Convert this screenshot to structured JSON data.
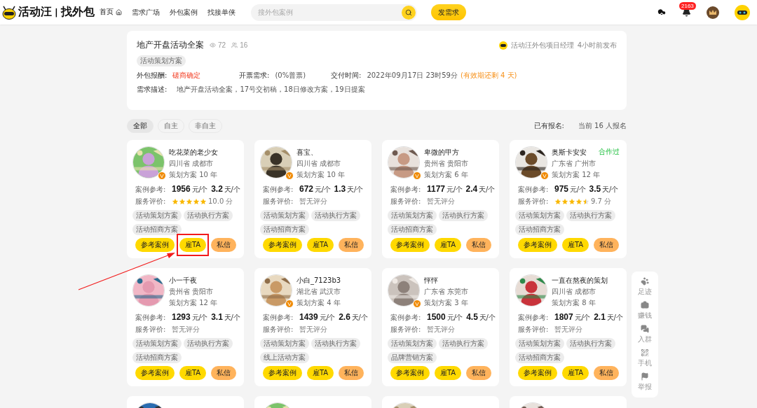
{
  "header": {
    "logo_text": "活动汪",
    "logo_divider": "|",
    "logo_sub": "找外包",
    "nav": [
      {
        "label": "首页",
        "selected": true
      },
      {
        "label": "需求广场",
        "selected": false
      },
      {
        "label": "外包案例",
        "selected": false
      },
      {
        "label": "找接单侠",
        "selected": false
      }
    ],
    "search": {
      "placeholder": "搜外包案例"
    },
    "post_button": "发需求",
    "notification_count": "2163"
  },
  "demand": {
    "title": "地产开盘活动全案",
    "views": "72",
    "applicants": "16",
    "publisher": "活动汪外包项目经理",
    "posted": "4小时前发布",
    "tags": [
      "活动策划方案"
    ],
    "info": [
      {
        "label": "外包报酬:",
        "value": "磋商确定",
        "alert": true
      },
      {
        "label": "开票需求:",
        "value": "(0%普票)",
        "alert": false
      },
      {
        "label": "交付时间:",
        "value": "2022年09月17日 23时59分",
        "alert": false,
        "note": "(有效期还剩 4 天)"
      }
    ],
    "description_label": "需求描述:",
    "description": "地产开盘活动全案，17号交初稿，18日修改方案，19日提案"
  },
  "filters": [
    {
      "label": "全部",
      "selected": true
    },
    {
      "label": "自主",
      "selected": false
    },
    {
      "label": "非自主",
      "selected": false
    }
  ],
  "signup": {
    "label": "已有报名:",
    "value": "当前 16 人报名"
  },
  "cards": [
    {
      "name": "吃花菜的老少女",
      "location": "四川省 成都市",
      "experience": "策划方案 10 年",
      "badge": "V",
      "case_label": "案例参考:",
      "price": "1956",
      "price_unit": "元/个",
      "days": "3.2",
      "days_unit": "天/个",
      "rating_label": "服务评价:",
      "stars": 5,
      "score": "10.0 分",
      "tags": [
        "活动策划方案",
        "活动执行方案",
        "活动招商方案"
      ],
      "buttons": [
        "参考案例",
        "雇TA",
        "私信"
      ],
      "highlighted": true
    },
    {
      "name": "喜宝、",
      "location": "四川省 成都市",
      "experience": "策划方案 10 年",
      "badge": "V",
      "case_label": "案例参考:",
      "price": "672",
      "price_unit": "元/个",
      "days": "1.3",
      "days_unit": "天/个",
      "rating_label": "服务评价:",
      "score": "暂无评分",
      "tags": [
        "活动策划方案",
        "活动执行方案",
        "活动招商方案"
      ],
      "buttons": [
        "参考案例",
        "雇TA",
        "私信"
      ],
      "highlighted": false
    },
    {
      "name": "卑微的甲方",
      "location": "贵州省 贵阳市",
      "experience": "策划方案 6 年",
      "badge": "V",
      "case_label": "案例参考:",
      "price": "1177",
      "price_unit": "元/个",
      "days": "2.4",
      "days_unit": "天/个",
      "rating_label": "服务评价:",
      "score": "暂无评分",
      "tags": [
        "活动策划方案",
        "活动执行方案",
        "活动招商方案"
      ],
      "buttons": [
        "参考案例",
        "雇TA",
        "私信"
      ],
      "highlighted": false
    },
    {
      "name": "奥斯卡安安",
      "location": "广东省 广州市",
      "experience": "策划方案 12 年",
      "badge": "V",
      "cooperated": "合作过",
      "case_label": "案例参考:",
      "price": "975",
      "price_unit": "元/个",
      "days": "3.5",
      "days_unit": "天/个",
      "rating_label": "服务评价:",
      "stars": 4.5,
      "score": "9.7 分",
      "tags": [
        "活动策划方案",
        "活动执行方案",
        "活动招商方案"
      ],
      "buttons": [
        "参考案例",
        "雇TA",
        "私信"
      ],
      "highlighted": false
    },
    {
      "name": "小一千夜",
      "location": "贵州省 贵阳市",
      "experience": "策划方案 12 年",
      "case_label": "案例参考:",
      "price": "1293",
      "price_unit": "元/个",
      "days": "3.1",
      "days_unit": "天/个",
      "rating_label": "服务评价:",
      "score": "暂无评分",
      "tags": [
        "活动策划方案",
        "活动执行方案",
        "活动招商方案"
      ],
      "buttons": [
        "参考案例",
        "雇TA",
        "私信"
      ],
      "highlighted": false
    },
    {
      "name": "小白_7123b3",
      "location": "湖北省 武汉市",
      "experience": "策划方案 4 年",
      "badge": "V",
      "case_label": "案例参考:",
      "price": "1439",
      "price_unit": "元/个",
      "days": "2.6",
      "days_unit": "天/个",
      "rating_label": "服务评价:",
      "score": "暂无评分",
      "tags": [
        "活动策划方案",
        "活动执行方案",
        "线上活动方案"
      ],
      "buttons": [
        "参考案例",
        "雇TA",
        "私信"
      ],
      "highlighted": false
    },
    {
      "name": "怦怦",
      "location": "广东省 东莞市",
      "experience": "策划方案 3 年",
      "badge": "V",
      "case_label": "案例参考:",
      "price": "1500",
      "price_unit": "元/个",
      "days": "4.5",
      "days_unit": "天/个",
      "rating_label": "服务评价:",
      "score": "暂无评分",
      "tags": [
        "活动策划方案",
        "活动执行方案",
        "品牌营销方案"
      ],
      "buttons": [
        "参考案例",
        "雇TA",
        "私信"
      ],
      "highlighted": false
    },
    {
      "name": "一直在熬夜的策划",
      "location": "四川省 成都市",
      "experience": "策划方案 8 年",
      "case_label": "案例参考:",
      "price": "1807",
      "price_unit": "元/个",
      "days": "2.1",
      "days_unit": "天/个",
      "rating_label": "服务评价:",
      "score": "暂无评分",
      "tags": [
        "活动策划方案",
        "活动执行方案",
        "活动招商方案"
      ],
      "buttons": [
        "参考案例",
        "雇TA",
        "私信"
      ],
      "highlighted": false
    }
  ],
  "side_rail": [
    {
      "label": "足迹"
    },
    {
      "label": "赚钱"
    },
    {
      "label": "入群"
    },
    {
      "label": "手机"
    },
    {
      "label": "举报"
    }
  ]
}
